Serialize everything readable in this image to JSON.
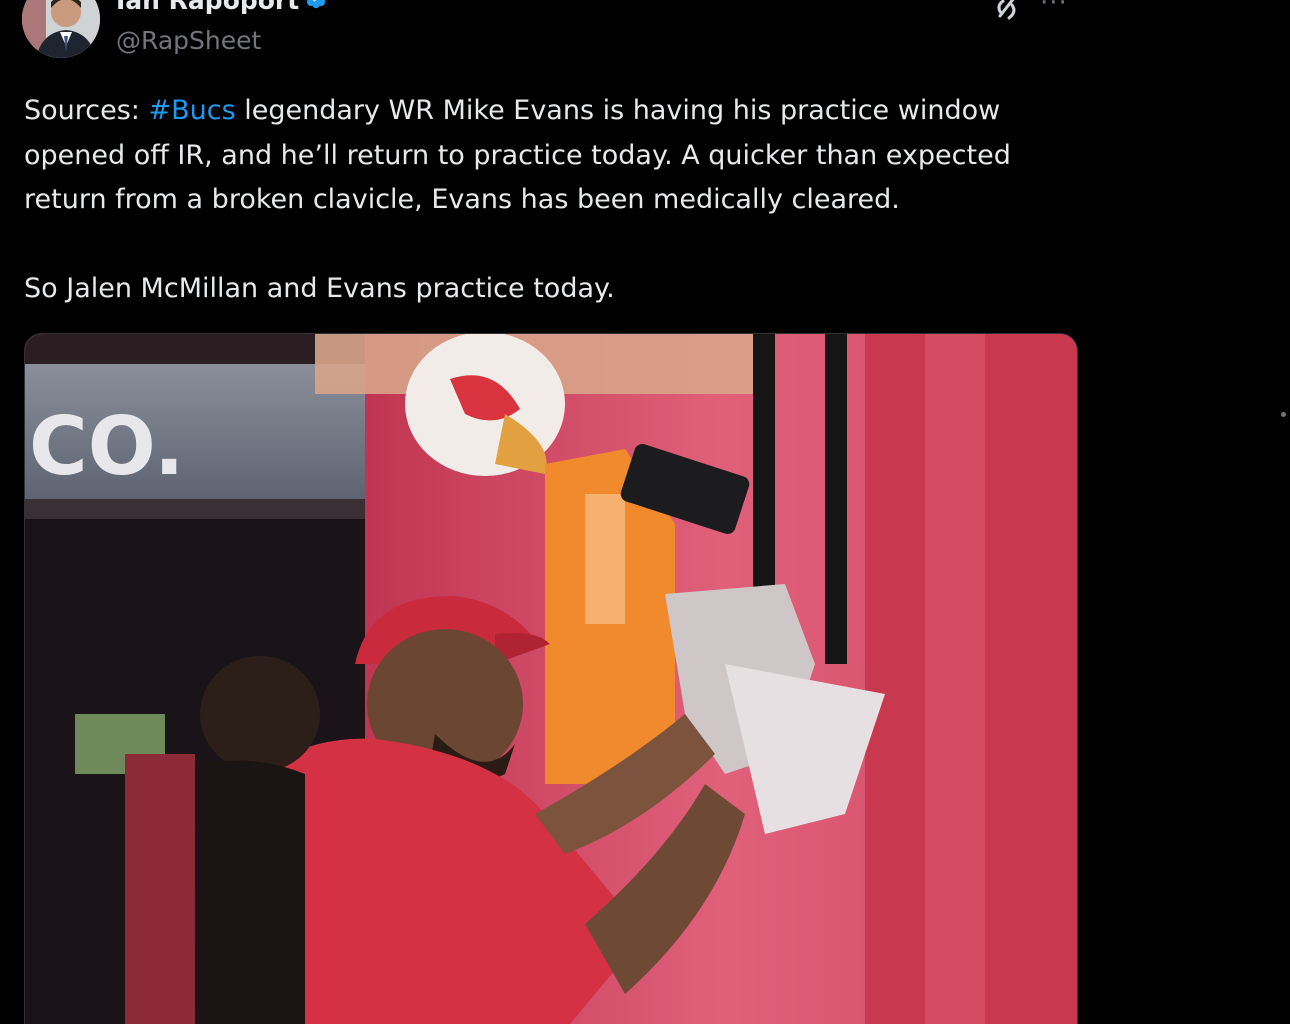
{
  "author": {
    "name": "Ian Rapoport",
    "handle": "@RapSheet",
    "verified": true
  },
  "icons": {
    "avatar": "profile-photo",
    "verified": "verified-badge-icon",
    "grok": "grok-icon",
    "more": "more-options-icon"
  },
  "more_label": "···",
  "tweet": {
    "text_before_hashtag": "Sources: ",
    "hashtag": "#Bucs",
    "text_after_hashtag": " legendary WR Mike Evans is having his practice window opened off IR, and he’ll return to practice today. A quicker than expected return from a broken clavicle, Evans has been medically cleared.",
    "second_paragraph": "So Jalen McMillan and Evans practice today."
  },
  "media": {
    "type": "photo",
    "stadium_sign_fragment": "CO."
  },
  "colors": {
    "background": "#000000",
    "text": "#e7e9ea",
    "secondary": "#71767b",
    "link": "#1d9bf0",
    "verified": "#1d9bf0"
  }
}
